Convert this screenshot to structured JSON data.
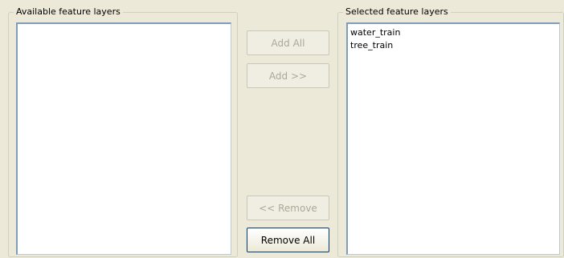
{
  "available_group": {
    "title": "Available feature layers",
    "items": []
  },
  "selected_group": {
    "title": "Selected feature layers",
    "items": [
      "water_train",
      "tree_train"
    ]
  },
  "buttons": {
    "add_all": "Add All",
    "add": "Add >>",
    "remove": "<< Remove",
    "remove_all": "Remove All"
  }
}
